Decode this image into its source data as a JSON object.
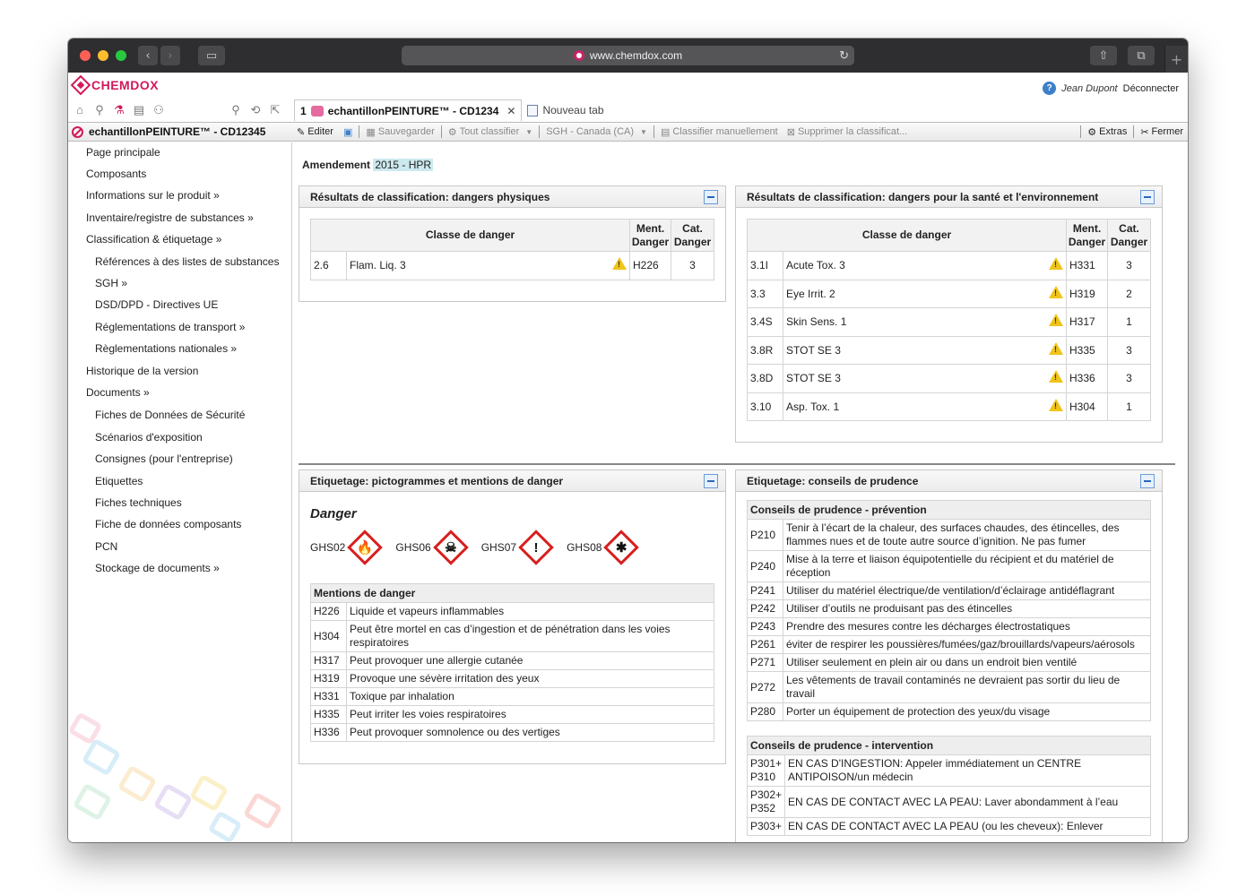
{
  "browser": {
    "url": "www.chemdox.com",
    "nav_back": "‹",
    "nav_forward": "›",
    "sidebar_btn": "▭",
    "share_btn": "⇧",
    "tabs_btn": "⧉",
    "new_tab_btn": "+"
  },
  "app": {
    "logo": "CHEMDOX",
    "user_name": "Jean Dupont",
    "disconnect": "Déconnecter",
    "help": "?"
  },
  "tabs": [
    {
      "number": "1",
      "label": "echantillonPEINTURE™ - CD1234",
      "close": "✕"
    },
    {
      "label": "Nouveau tab"
    }
  ],
  "object_title": "echantillonPEINTURE™ - CD12345",
  "toolbar": {
    "edit": "Editer",
    "save": "Sauvegarder",
    "classify_all": "Tout classifier",
    "region": "SGH - Canada (CA)",
    "classify_manual": "Classifier manuellement",
    "delete_classification": "Supprimer la classificat...",
    "extras": "Extras",
    "close": "Fermer"
  },
  "sidebar": {
    "items": [
      {
        "label": "Page principale",
        "level": 0
      },
      {
        "label": "Composants",
        "level": 0
      },
      {
        "label": "Informations sur le produit »",
        "level": 0
      },
      {
        "label": "Inventaire/registre de substances »",
        "level": 0
      },
      {
        "label": "Classification & étiquetage »",
        "level": 0
      },
      {
        "label": "Références à des listes de substances",
        "level": 1
      },
      {
        "label": "SGH »",
        "level": 1
      },
      {
        "label": "DSD/DPD - Directives UE",
        "level": 1
      },
      {
        "label": "Réglementations de transport »",
        "level": 1
      },
      {
        "label": "Règlementations nationales »",
        "level": 1
      },
      {
        "label": "Historique de la version",
        "level": 0
      },
      {
        "label": "Documents »",
        "level": 0
      },
      {
        "label": "Fiches de Données de Sécurité",
        "level": 1
      },
      {
        "label": "Scénarios d'exposition",
        "level": 1
      },
      {
        "label": "Consignes (pour l'entreprise)",
        "level": 1
      },
      {
        "label": "Etiquettes",
        "level": 1
      },
      {
        "label": "Fiches techniques",
        "level": 1
      },
      {
        "label": "Fiche de données composants",
        "level": 1
      },
      {
        "label": "PCN",
        "level": 1
      },
      {
        "label": "Stockage de documents »",
        "level": 1
      }
    ]
  },
  "amendment": {
    "label": "Amendement",
    "value": "2015 - HPR"
  },
  "physical": {
    "title": "Résultats de classification: dangers physiques",
    "headers": {
      "class": "Classe de danger",
      "statement_1": "Ment.",
      "statement_2": "Danger",
      "cat_1": "Cat.",
      "cat_2": "Danger"
    },
    "rows": [
      {
        "code": "2.6",
        "name": "Flam. Liq. 3",
        "h": "H226",
        "cat": "3"
      }
    ]
  },
  "health": {
    "title": "Résultats de classification: dangers pour la santé et l'environnement",
    "headers": {
      "class": "Classe de danger",
      "statement_1": "Ment.",
      "statement_2": "Danger",
      "cat_1": "Cat.",
      "cat_2": "Danger"
    },
    "rows": [
      {
        "code": "3.1I",
        "name": "Acute Tox. 3",
        "h": "H331",
        "cat": "3"
      },
      {
        "code": "3.3",
        "name": "Eye Irrit. 2",
        "h": "H319",
        "cat": "2"
      },
      {
        "code": "3.4S",
        "name": "Skin Sens. 1",
        "h": "H317",
        "cat": "1"
      },
      {
        "code": "3.8R",
        "name": "STOT SE 3",
        "h": "H335",
        "cat": "3"
      },
      {
        "code": "3.8D",
        "name": "STOT SE 3",
        "h": "H336",
        "cat": "3"
      },
      {
        "code": "3.10",
        "name": "Asp. Tox. 1",
        "h": "H304",
        "cat": "1"
      }
    ]
  },
  "labeling": {
    "title": "Etiquetage: pictogrammes et mentions de danger",
    "signal_word": "Danger",
    "pictograms": [
      {
        "code": "GHS02",
        "icon": "flame-icon",
        "glyph": "🔥"
      },
      {
        "code": "GHS06",
        "icon": "skull-crossbones-icon",
        "glyph": "☠"
      },
      {
        "code": "GHS07",
        "icon": "exclamation-icon",
        "glyph": "!"
      },
      {
        "code": "GHS08",
        "icon": "health-hazard-icon",
        "glyph": "✱"
      }
    ],
    "statements_title": "Mentions de danger",
    "statements": [
      {
        "code": "H226",
        "text": "Liquide et vapeurs inflammables"
      },
      {
        "code": "H304",
        "text": "Peut être mortel en cas d’ingestion et de pénétration dans les voies respiratoires"
      },
      {
        "code": "H317",
        "text": "Peut provoquer une allergie cutanée"
      },
      {
        "code": "H319",
        "text": "Provoque une sévère irritation des yeux"
      },
      {
        "code": "H331",
        "text": "Toxique par inhalation"
      },
      {
        "code": "H335",
        "text": "Peut irriter les voies respiratoires"
      },
      {
        "code": "H336",
        "text": "Peut provoquer somnolence ou des vertiges"
      }
    ]
  },
  "precaution": {
    "title": "Etiquetage: conseils de prudence",
    "prevention_title": "Conseils de prudence - prévention",
    "prevention": [
      {
        "code": "P210",
        "text": "Tenir à l’écart de la chaleur, des surfaces chaudes, des étincelles, des flammes nues et de toute autre source d’ignition. Ne pas fumer"
      },
      {
        "code": "P240",
        "text": "Mise à la terre et liaison équipotentielle du récipient et du matériel de réception"
      },
      {
        "code": "P241",
        "text": "Utiliser du matériel électrique/de ventilation/d’éclairage antidéflagrant"
      },
      {
        "code": "P242",
        "text": "Utiliser d’outils ne produisant pas des étincelles"
      },
      {
        "code": "P243",
        "text": "Prendre des mesures contre les décharges électrostatiques"
      },
      {
        "code": "P261",
        "text": "éviter de respirer les poussières/fumées/gaz/brouillards/vapeurs/aérosols"
      },
      {
        "code": "P271",
        "text": "Utiliser seulement en plein air ou dans un endroit bien ventilé"
      },
      {
        "code": "P272",
        "text": "Les vêtements de travail contaminés ne devraient pas sortir du lieu de travail"
      },
      {
        "code": "P280",
        "text": "Porter un équipement de protection des yeux/du visage"
      }
    ],
    "intervention_title": "Conseils de prudence - intervention",
    "intervention": [
      {
        "code": "P301+ P310",
        "text": "EN CAS D'INGESTION: Appeler immédiatement un CENTRE ANTIPOISON/un médecin"
      },
      {
        "code": "P302+ P352",
        "text": "EN CAS DE CONTACT AVEC LA PEAU: Laver abondamment à l’eau"
      },
      {
        "code": "P303+",
        "text": "EN CAS DE CONTACT AVEC LA PEAU (ou les cheveux): Enlever"
      }
    ]
  }
}
